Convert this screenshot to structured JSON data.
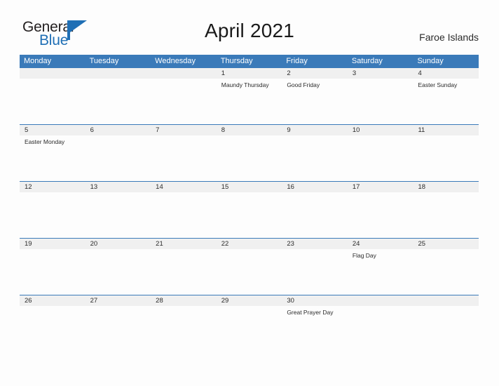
{
  "brand": {
    "name_primary": "General",
    "name_secondary": "Blue",
    "mark": "pennant-flag-icon",
    "color_primary": "#231f20",
    "color_secondary": "#1f6fb5"
  },
  "header": {
    "title": "April 2021",
    "region": "Faroe Islands"
  },
  "colors": {
    "header_blue": "#3a7ab9",
    "daynum_band": "#f0f0f0",
    "page_background": "#fdfdfd",
    "text": "#2a2a2a"
  },
  "calendar": {
    "month": "April",
    "year": "2021",
    "weekdays": [
      "Monday",
      "Tuesday",
      "Wednesday",
      "Thursday",
      "Friday",
      "Saturday",
      "Sunday"
    ],
    "weeks": [
      [
        {
          "day": "",
          "event": ""
        },
        {
          "day": "",
          "event": ""
        },
        {
          "day": "",
          "event": ""
        },
        {
          "day": "1",
          "event": "Maundy Thursday"
        },
        {
          "day": "2",
          "event": "Good Friday"
        },
        {
          "day": "3",
          "event": ""
        },
        {
          "day": "4",
          "event": "Easter Sunday"
        }
      ],
      [
        {
          "day": "5",
          "event": "Easter Monday"
        },
        {
          "day": "6",
          "event": ""
        },
        {
          "day": "7",
          "event": ""
        },
        {
          "day": "8",
          "event": ""
        },
        {
          "day": "9",
          "event": ""
        },
        {
          "day": "10",
          "event": ""
        },
        {
          "day": "11",
          "event": ""
        }
      ],
      [
        {
          "day": "12",
          "event": ""
        },
        {
          "day": "13",
          "event": ""
        },
        {
          "day": "14",
          "event": ""
        },
        {
          "day": "15",
          "event": ""
        },
        {
          "day": "16",
          "event": ""
        },
        {
          "day": "17",
          "event": ""
        },
        {
          "day": "18",
          "event": ""
        }
      ],
      [
        {
          "day": "19",
          "event": ""
        },
        {
          "day": "20",
          "event": ""
        },
        {
          "day": "21",
          "event": ""
        },
        {
          "day": "22",
          "event": ""
        },
        {
          "day": "23",
          "event": ""
        },
        {
          "day": "24",
          "event": "Flag Day"
        },
        {
          "day": "25",
          "event": ""
        }
      ],
      [
        {
          "day": "26",
          "event": ""
        },
        {
          "day": "27",
          "event": ""
        },
        {
          "day": "28",
          "event": ""
        },
        {
          "day": "29",
          "event": ""
        },
        {
          "day": "30",
          "event": "Great Prayer Day"
        },
        {
          "day": "",
          "event": ""
        },
        {
          "day": "",
          "event": ""
        }
      ]
    ]
  }
}
